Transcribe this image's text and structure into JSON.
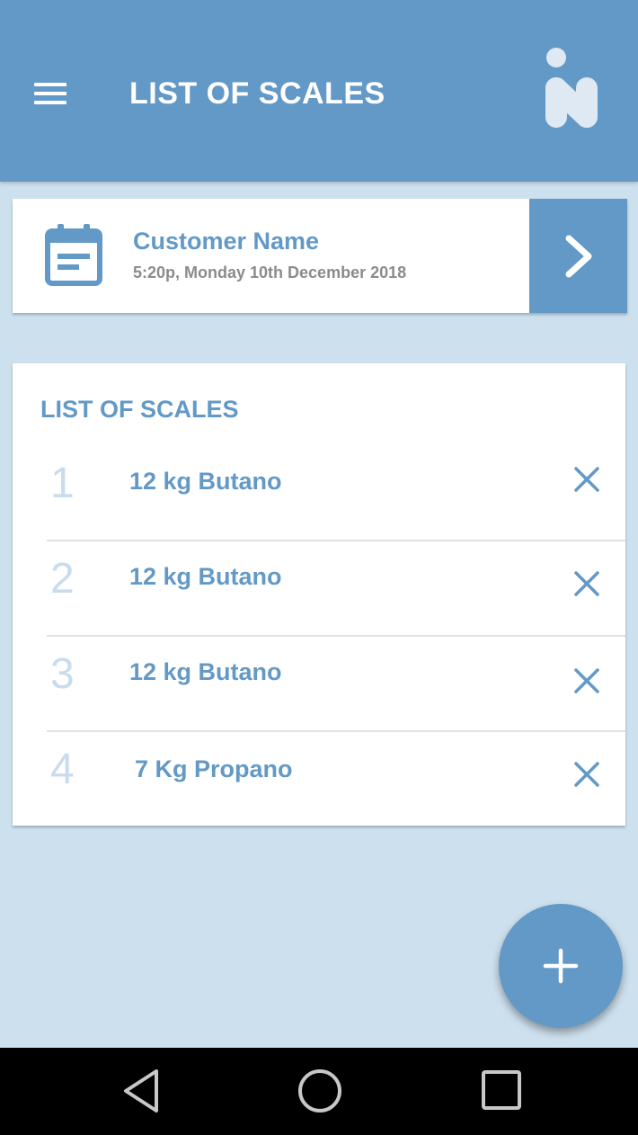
{
  "appbar": {
    "title": "LIST OF SCALES",
    "menu_icon": "hamburger-menu-icon",
    "logo_icon": "app-logo-icon"
  },
  "customer": {
    "name": "Customer Name",
    "datetime": "5:20p, Monday 10th December 2018",
    "calendar_icon": "calendar-icon",
    "go_icon": "chevron-right-icon"
  },
  "scales": {
    "title": "LIST OF SCALES",
    "items": [
      {
        "number": "1",
        "label": "12 kg Butano"
      },
      {
        "number": "2",
        "label": "12 kg Butano"
      },
      {
        "number": "3",
        "label": "12 kg Butano"
      },
      {
        "number": "4",
        "label": "7 Kg Propano"
      }
    ],
    "remove_icon": "close-icon"
  },
  "fab": {
    "icon": "plus-icon"
  },
  "navbar": {
    "back_icon": "triangle-back-icon",
    "home_icon": "circle-home-icon",
    "recent_icon": "square-recent-icon"
  },
  "colors": {
    "primary": "#6399c6",
    "background": "#cde0ee",
    "number_light": "#c9dced",
    "secondary_text": "#8b8b8b"
  }
}
